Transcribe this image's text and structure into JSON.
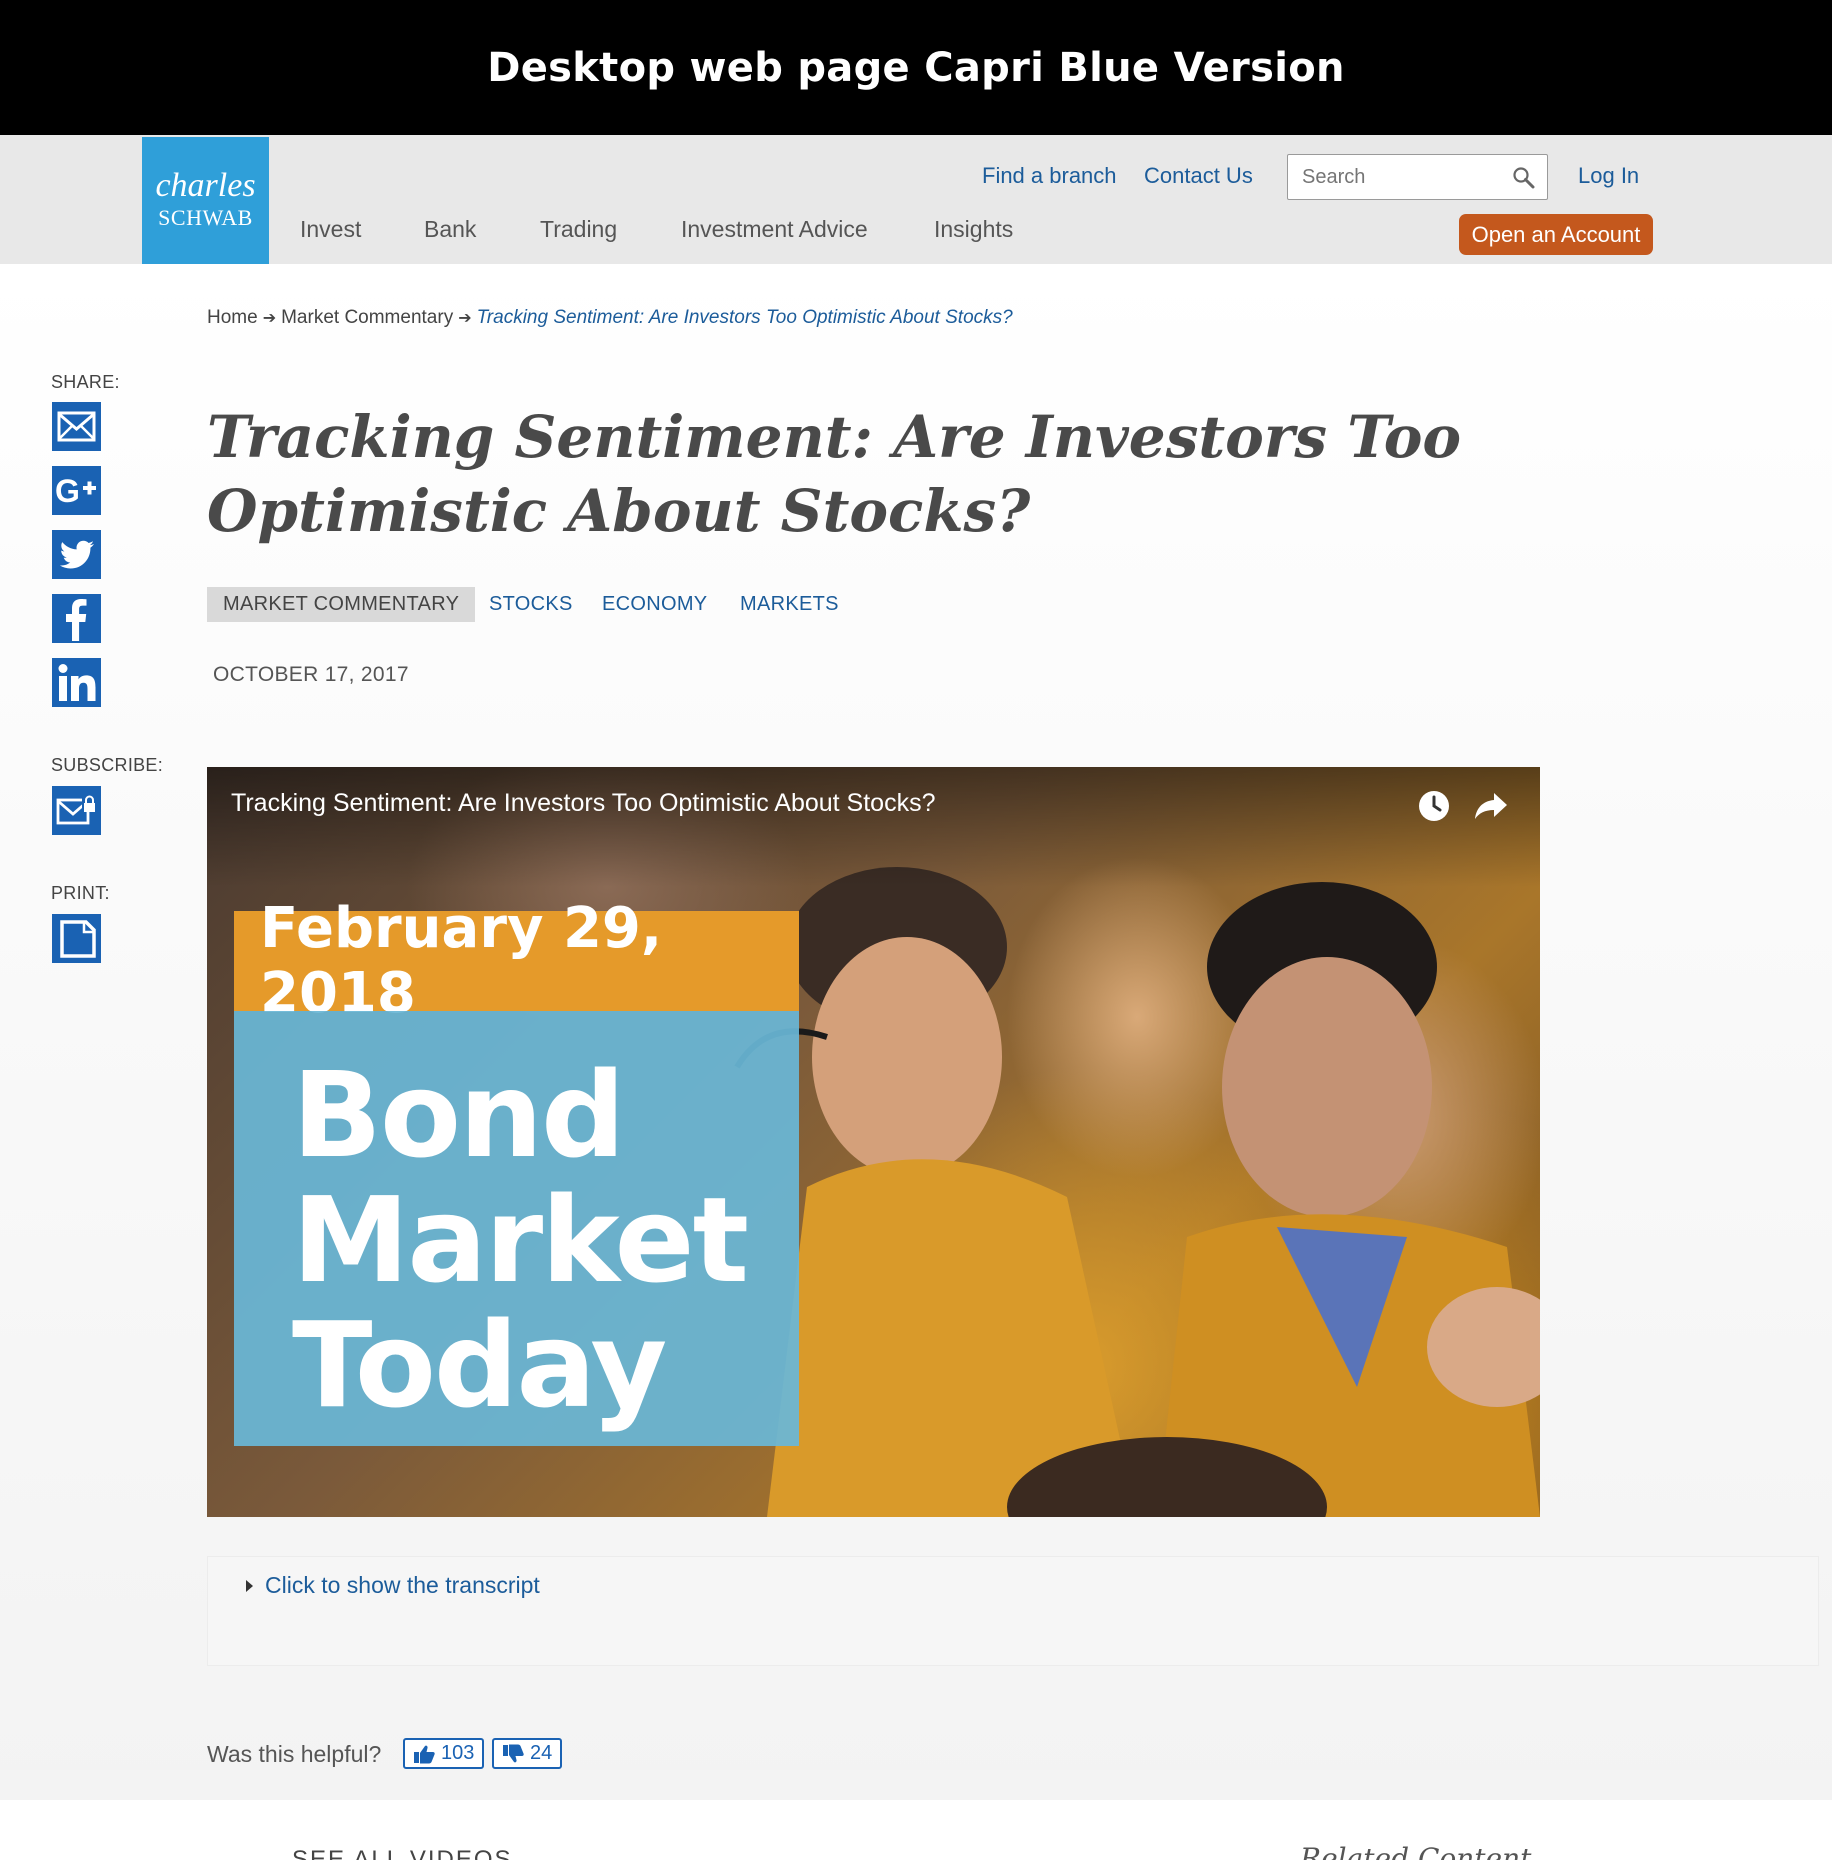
{
  "banner": {
    "title": "Desktop web page Capri Blue Version"
  },
  "logo": {
    "line1": "charles",
    "line2": "SCHWAB"
  },
  "header": {
    "find_branch": "Find a branch",
    "contact_us": "Contact Us",
    "search_placeholder": "Search",
    "log_in": "Log In",
    "open_account": "Open an Account",
    "nav": [
      "Invest",
      "Bank",
      "Trading",
      "Investment Advice",
      "Insights"
    ]
  },
  "breadcrumb": {
    "home": "Home",
    "section": "Market Commentary",
    "current": "Tracking Sentiment: Are Investors Too Optimistic About Stocks?"
  },
  "rail": {
    "share_label": "SHARE:",
    "subscribe_label": "SUBSCRIBE:",
    "print_label": "PRINT:",
    "share_icons": [
      "email-icon",
      "google-plus-icon",
      "twitter-icon",
      "facebook-icon",
      "linkedin-icon"
    ]
  },
  "article": {
    "title": "Tracking Sentiment: Are Investors Too Optimistic About Stocks?",
    "tags": [
      "MARKET COMMENTARY",
      "STOCKS",
      "ECONOMY",
      "MARKETS"
    ],
    "date": "OCTOBER 17, 2017"
  },
  "video": {
    "title": "Tracking Sentiment: Are Investors Too Optimistic About Stocks?",
    "card_date": "February 29, 2018",
    "card_lines": [
      "Bond",
      "Market",
      "Today"
    ]
  },
  "transcript": {
    "toggle_label": "Click to show the transcript"
  },
  "feedback": {
    "question": "Was this helpful?",
    "up_count": "103",
    "down_count": "24"
  },
  "footer": {
    "see_all": "SEE ALL VIDEOS",
    "related": "Related Content"
  },
  "colors": {
    "brand_blue": "#2f9fd9",
    "link_blue": "#1c5c9a",
    "cta_orange": "#c4581d",
    "icon_blue": "#1a62b3"
  }
}
